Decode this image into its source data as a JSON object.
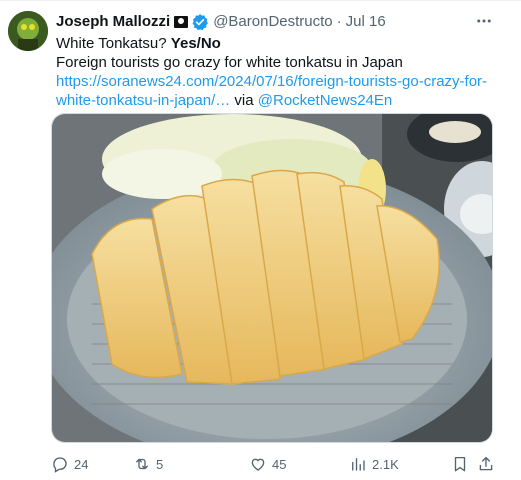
{
  "author": {
    "name": "Joseph Mallozzi",
    "flag_icon": "pirate-flag-icon",
    "verified_icon": "verified-badge-icon",
    "handle": "@BaronDestructo",
    "separator": "·",
    "date": "Jul 16",
    "avatar_icon": "avatar-image"
  },
  "more_icon": "more-horizontal-icon",
  "tweet": {
    "line1_plain": "White Tonkatsu? ",
    "line1_bold": "Yes/No",
    "line2": "Foreign tourists go crazy for white tonkatsu in Japan",
    "link_text": "https://soranews24.com/2024/07/16/foreign-tourists-go-crazy-for-white-tonkatsu-in-japan/…",
    "via_text": " via ",
    "mention": "@RocketNews24En"
  },
  "media": {
    "description_icon": "tonkatsu-photo"
  },
  "actions": {
    "replies": "24",
    "reposts": "5",
    "likes": "45",
    "views": "2.1K"
  },
  "colors": {
    "link": "#1d9bf0",
    "muted": "#536471",
    "text": "#0f1419",
    "verified": "#1d9bf0"
  }
}
